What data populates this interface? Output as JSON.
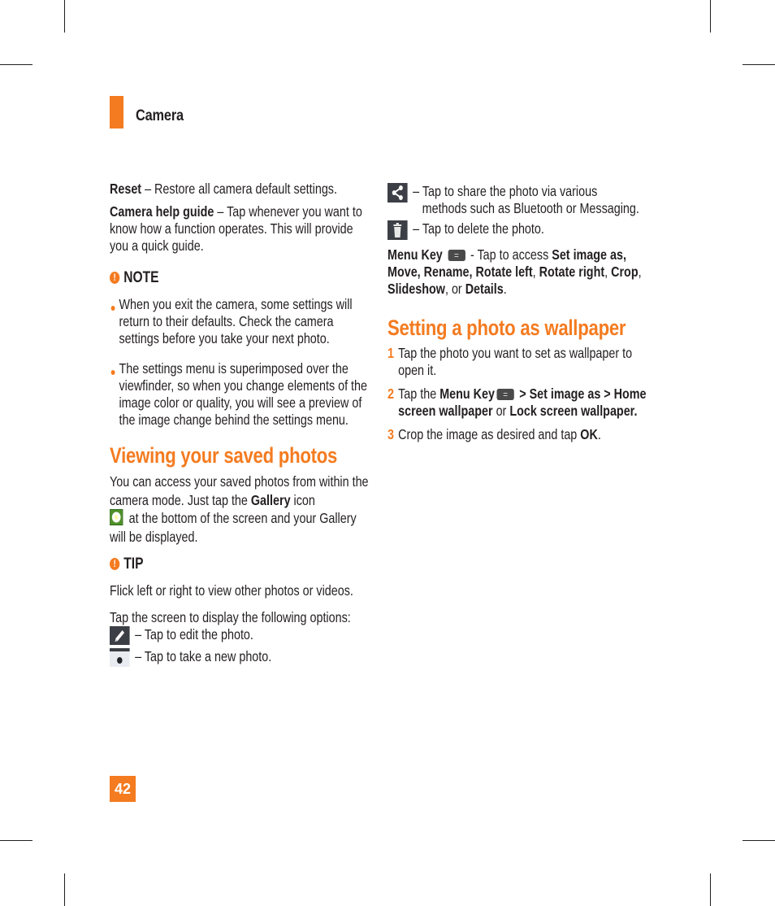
{
  "header": {
    "section_title": "Camera"
  },
  "left_column": {
    "reset": {
      "term": "Reset",
      "desc": " – Restore all camera default settings."
    },
    "help_guide": {
      "term": "Camera help guide",
      "desc": " – Tap whenever you want to know how a function operates. This will provide you a quick guide."
    },
    "note": {
      "label": "NOTE",
      "icon": "exclamation-icon",
      "bullets": [
        "When you exit the camera, some settings will return to their defaults. Check the camera settings before you take your next photo.",
        "The settings menu is superimposed over the viewfinder, so when you change elements of the image color or quality, you will see a preview of the image change behind the settings menu."
      ]
    },
    "viewing": {
      "heading": "Viewing your saved photos",
      "intro_1": "You can access your saved photos from within the camera mode. Just tap the ",
      "gallery_term": "Gallery",
      "intro_2": " icon",
      "intro_3": " at the bottom of the screen and your Gallery will be displayed.",
      "gallery_icon": "gallery-daisy-icon"
    },
    "tip": {
      "label": "TIP",
      "icon": "exclamation-icon",
      "para_1": "Flick left or right to view other photos or videos.",
      "para_2": "Tap the screen to display the following options:"
    },
    "options": [
      {
        "icon": "pencil-edit-icon",
        "text": "– Tap to edit the photo."
      },
      {
        "icon": "camera-icon",
        "text": "– Tap to take a new photo."
      }
    ]
  },
  "right_column": {
    "options": [
      {
        "icon": "share-icon",
        "text_first": "– Tap to share the photo via various",
        "text_rest": "methods such as Bluetooth or Messaging."
      },
      {
        "icon": "trash-icon",
        "text_first": "– Tap to delete the photo.",
        "text_rest": ""
      }
    ],
    "menu_key": {
      "term": "Menu Key",
      "icon": "menu-key-icon",
      "mid": " - Tap to access ",
      "items_bold_1": "Set image as, Move, Rename, Rotate left",
      "sep1": ", ",
      "items_bold_2": "Rotate right",
      "sep2": ", ",
      "items_bold_3": "Crop",
      "sep3": ", ",
      "items_bold_4": "Slideshow",
      "sep4": ", or ",
      "items_bold_5": "Details",
      "end": "."
    },
    "wallpaper": {
      "heading": "Setting a photo as wallpaper",
      "steps": [
        {
          "num": "1",
          "text": "Tap the photo you want to set as wallpaper to open it."
        },
        {
          "num": "2",
          "pre": "Tap the ",
          "bold_1": "Menu Key",
          "bold_2": " > Set image as > Home screen wallpaper",
          "mid": " or ",
          "bold_3": "Lock screen wallpaper."
        },
        {
          "num": "3",
          "pre": "Crop the image as desired and tap ",
          "bold_1": "OK",
          "end": "."
        }
      ]
    }
  },
  "footer": {
    "page_number": "42"
  },
  "colors": {
    "accent": "#f47b20",
    "text": "#231f20",
    "icon_bg": "#3c3f45"
  }
}
